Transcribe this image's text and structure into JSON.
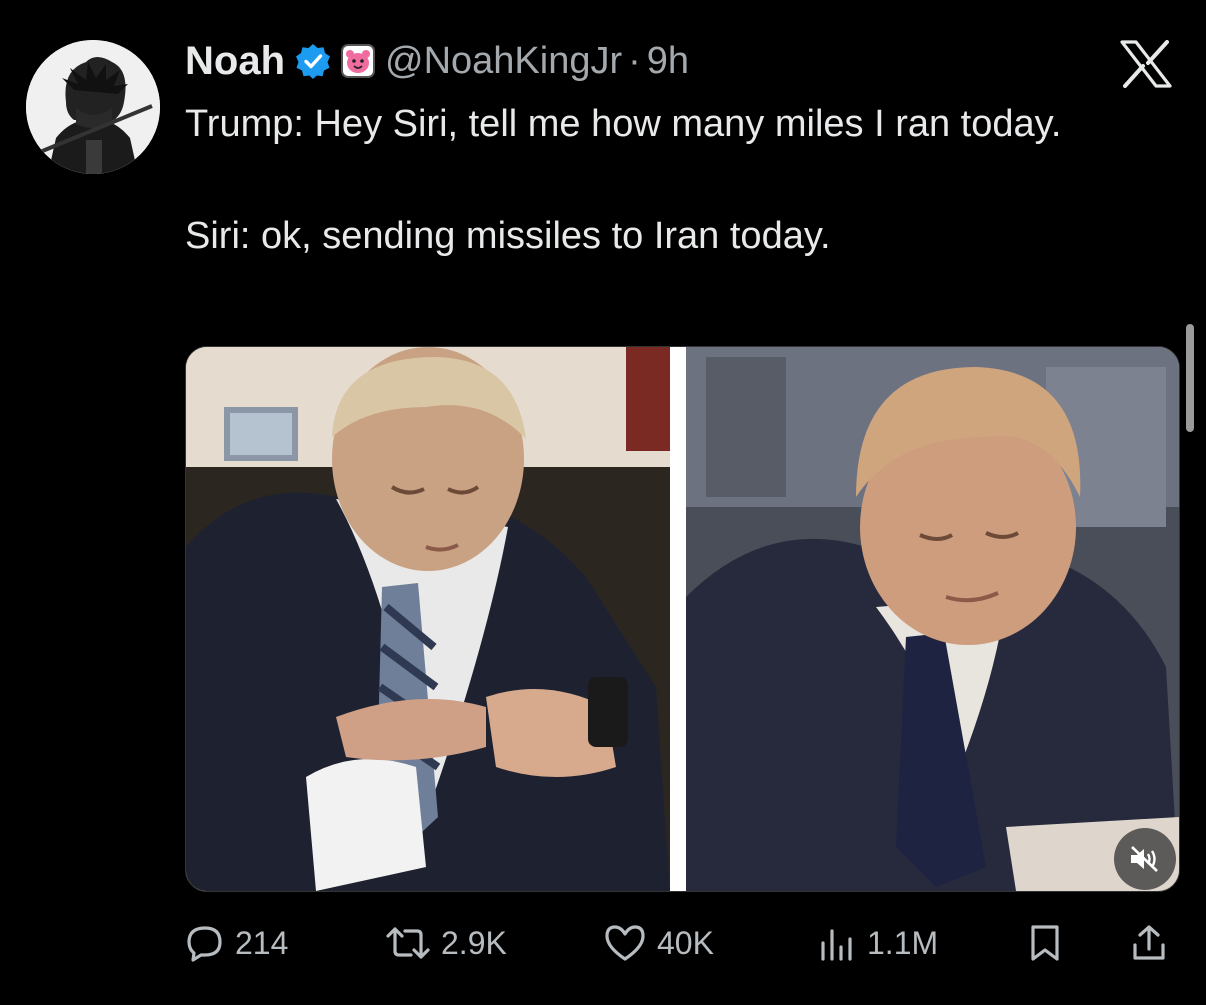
{
  "tweet": {
    "author_name": "Noah",
    "handle": "@NoahKingJr",
    "separator": "·",
    "time": "9h",
    "text": "Trump: Hey Siri, tell me how many miles I ran today.\n\nSiri: ok, sending missiles to Iran today."
  },
  "media": {
    "muted": true
  },
  "actions": {
    "replies": "214",
    "reposts": "2.9K",
    "likes": "40K",
    "views": "1.1M"
  },
  "colors": {
    "background": "#000000",
    "text": "#e7e9ea",
    "secondary": "#a4a9ae",
    "verified": "#1d9bf0",
    "affiliate": "#f06ca0"
  },
  "icons": [
    "verified-badge-icon",
    "affiliate-badge-icon",
    "x-logo-icon",
    "mute-icon",
    "reply-icon",
    "repost-icon",
    "like-icon",
    "views-icon",
    "bookmark-icon",
    "share-icon"
  ]
}
